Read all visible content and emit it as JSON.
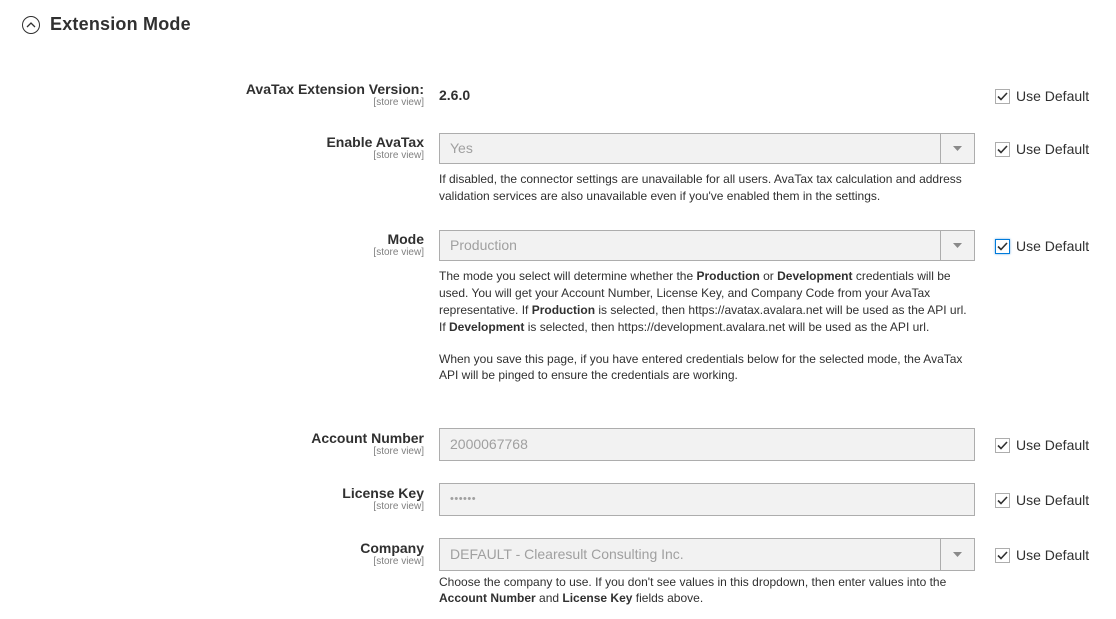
{
  "section": {
    "title": "Extension Mode"
  },
  "use_default_label": "Use Default",
  "scope_label": "[store view]",
  "rows": {
    "version": {
      "label": "AvaTax Extension Version:",
      "value": "2.6.0"
    },
    "enable": {
      "label": "Enable AvaTax",
      "value": "Yes",
      "note": "If disabled, the connector settings are unavailable for all users. AvaTax tax calculation and address validation services are also unavailable even if you've enabled them in the settings."
    },
    "mode": {
      "label": "Mode",
      "value": "Production",
      "note1": [
        "The mode you select will determine whether the ",
        "Production",
        " or ",
        "Development",
        " credentials will be used. You will get your Account Number, License Key, and Company Code from your AvaTax representative. If ",
        "Production",
        " is selected, then https://avatax.avalara.net will be used as the API url. If ",
        "Development",
        " is selected, then https://development.avalara.net will be used as the API url."
      ],
      "note2": "When you save this page, if you have entered credentials below for the selected mode, the AvaTax API will be pinged to ensure the credentials are working."
    },
    "account": {
      "label": "Account Number",
      "value": "2000067768"
    },
    "license": {
      "label": "License Key",
      "value": "••••••"
    },
    "company": {
      "label": "Company",
      "value": "DEFAULT - Clearesult Consulting Inc.",
      "note": [
        "Choose the company to use. If you don't see values in this dropdown, then enter values into the ",
        "Account Number",
        " and ",
        "License Key",
        " fields above."
      ]
    }
  },
  "icons": {
    "collapse": "chevron-up-circle-icon",
    "checkbox": "checkmark-icon",
    "dropdown": "caret-down-icon"
  },
  "colors": {
    "text": "#303030",
    "scope": "#808080",
    "field_bg": "#f2f2f2",
    "field_border": "#adadad",
    "focus": "#007bdb"
  }
}
